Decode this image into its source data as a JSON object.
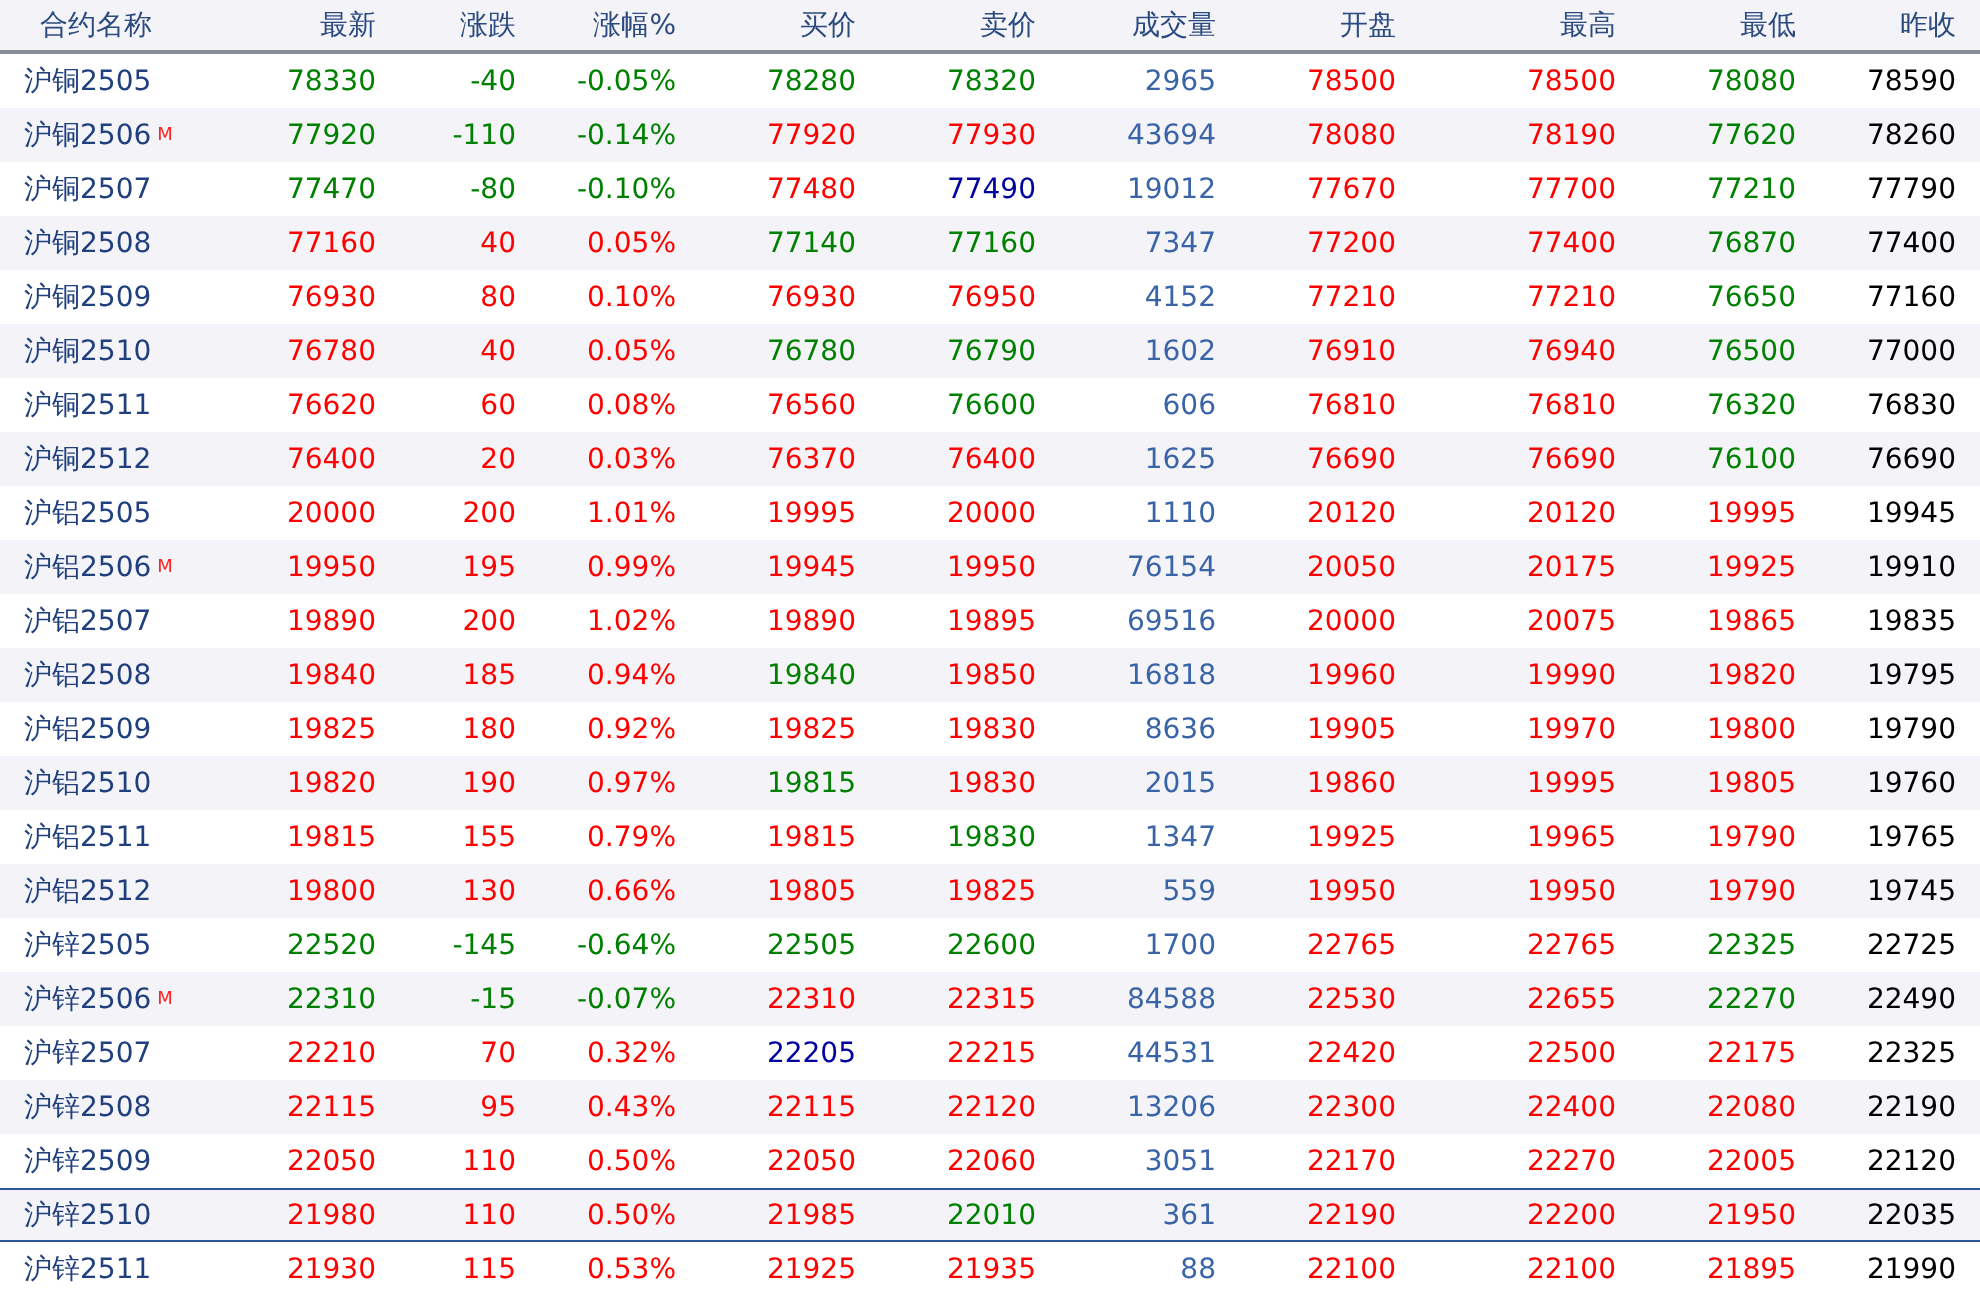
{
  "table": {
    "columns": [
      "合约名称",
      "最新",
      "涨跌",
      "涨幅%",
      "买价",
      "卖价",
      "成交量",
      "开盘",
      "最高",
      "最低",
      "昨收"
    ],
    "rows": [
      {
        "selected": false,
        "cells": [
          {
            "text": "沪铜2505",
            "color": "#1f3f7f"
          },
          {
            "text": "78330",
            "color": "#008000"
          },
          {
            "text": "-40",
            "color": "#008000"
          },
          {
            "text": "-0.05%",
            "color": "#008000"
          },
          {
            "text": "78280",
            "color": "#008000"
          },
          {
            "text": "78320",
            "color": "#008000"
          },
          {
            "text": "2965",
            "color": "#3a64a8"
          },
          {
            "text": "78500",
            "color": "#ff0000"
          },
          {
            "text": "78500",
            "color": "#ff0000"
          },
          {
            "text": "78080",
            "color": "#008000"
          },
          {
            "text": "78590",
            "color": "#000000"
          }
        ]
      },
      {
        "mark": "M",
        "selected": false,
        "cells": [
          {
            "text": "沪铜2506",
            "color": "#1f3f7f"
          },
          {
            "text": "77920",
            "color": "#008000"
          },
          {
            "text": "-110",
            "color": "#008000"
          },
          {
            "text": "-0.14%",
            "color": "#008000"
          },
          {
            "text": "77920",
            "color": "#ff0000"
          },
          {
            "text": "77930",
            "color": "#ff0000"
          },
          {
            "text": "43694",
            "color": "#3a64a8"
          },
          {
            "text": "78080",
            "color": "#ff0000"
          },
          {
            "text": "78190",
            "color": "#ff0000"
          },
          {
            "text": "77620",
            "color": "#008000"
          },
          {
            "text": "78260",
            "color": "#000000"
          }
        ]
      },
      {
        "selected": false,
        "cells": [
          {
            "text": "沪铜2507",
            "color": "#1f3f7f"
          },
          {
            "text": "77470",
            "color": "#008000"
          },
          {
            "text": "-80",
            "color": "#008000"
          },
          {
            "text": "-0.10%",
            "color": "#008000"
          },
          {
            "text": "77480",
            "color": "#ff0000"
          },
          {
            "text": "77490",
            "color": "#0000a0"
          },
          {
            "text": "19012",
            "color": "#3a64a8"
          },
          {
            "text": "77670",
            "color": "#ff0000"
          },
          {
            "text": "77700",
            "color": "#ff0000"
          },
          {
            "text": "77210",
            "color": "#008000"
          },
          {
            "text": "77790",
            "color": "#000000"
          }
        ]
      },
      {
        "selected": false,
        "cells": [
          {
            "text": "沪铜2508",
            "color": "#1f3f7f"
          },
          {
            "text": "77160",
            "color": "#ff0000"
          },
          {
            "text": "40",
            "color": "#ff0000"
          },
          {
            "text": "0.05%",
            "color": "#ff0000"
          },
          {
            "text": "77140",
            "color": "#008000"
          },
          {
            "text": "77160",
            "color": "#008000"
          },
          {
            "text": "7347",
            "color": "#3a64a8"
          },
          {
            "text": "77200",
            "color": "#ff0000"
          },
          {
            "text": "77400",
            "color": "#ff0000"
          },
          {
            "text": "76870",
            "color": "#008000"
          },
          {
            "text": "77400",
            "color": "#000000"
          }
        ]
      },
      {
        "selected": false,
        "cells": [
          {
            "text": "沪铜2509",
            "color": "#1f3f7f"
          },
          {
            "text": "76930",
            "color": "#ff0000"
          },
          {
            "text": "80",
            "color": "#ff0000"
          },
          {
            "text": "0.10%",
            "color": "#ff0000"
          },
          {
            "text": "76930",
            "color": "#ff0000"
          },
          {
            "text": "76950",
            "color": "#ff0000"
          },
          {
            "text": "4152",
            "color": "#3a64a8"
          },
          {
            "text": "77210",
            "color": "#ff0000"
          },
          {
            "text": "77210",
            "color": "#ff0000"
          },
          {
            "text": "76650",
            "color": "#008000"
          },
          {
            "text": "77160",
            "color": "#000000"
          }
        ]
      },
      {
        "selected": false,
        "cells": [
          {
            "text": "沪铜2510",
            "color": "#1f3f7f"
          },
          {
            "text": "76780",
            "color": "#ff0000"
          },
          {
            "text": "40",
            "color": "#ff0000"
          },
          {
            "text": "0.05%",
            "color": "#ff0000"
          },
          {
            "text": "76780",
            "color": "#008000"
          },
          {
            "text": "76790",
            "color": "#008000"
          },
          {
            "text": "1602",
            "color": "#3a64a8"
          },
          {
            "text": "76910",
            "color": "#ff0000"
          },
          {
            "text": "76940",
            "color": "#ff0000"
          },
          {
            "text": "76500",
            "color": "#008000"
          },
          {
            "text": "77000",
            "color": "#000000"
          }
        ]
      },
      {
        "selected": false,
        "cells": [
          {
            "text": "沪铜2511",
            "color": "#1f3f7f"
          },
          {
            "text": "76620",
            "color": "#ff0000"
          },
          {
            "text": "60",
            "color": "#ff0000"
          },
          {
            "text": "0.08%",
            "color": "#ff0000"
          },
          {
            "text": "76560",
            "color": "#ff0000"
          },
          {
            "text": "76600",
            "color": "#008000"
          },
          {
            "text": "606",
            "color": "#3a64a8"
          },
          {
            "text": "76810",
            "color": "#ff0000"
          },
          {
            "text": "76810",
            "color": "#ff0000"
          },
          {
            "text": "76320",
            "color": "#008000"
          },
          {
            "text": "76830",
            "color": "#000000"
          }
        ]
      },
      {
        "selected": false,
        "cells": [
          {
            "text": "沪铜2512",
            "color": "#1f3f7f"
          },
          {
            "text": "76400",
            "color": "#ff0000"
          },
          {
            "text": "20",
            "color": "#ff0000"
          },
          {
            "text": "0.03%",
            "color": "#ff0000"
          },
          {
            "text": "76370",
            "color": "#ff0000"
          },
          {
            "text": "76400",
            "color": "#ff0000"
          },
          {
            "text": "1625",
            "color": "#3a64a8"
          },
          {
            "text": "76690",
            "color": "#ff0000"
          },
          {
            "text": "76690",
            "color": "#ff0000"
          },
          {
            "text": "76100",
            "color": "#008000"
          },
          {
            "text": "76690",
            "color": "#000000"
          }
        ]
      },
      {
        "selected": false,
        "cells": [
          {
            "text": "沪铝2505",
            "color": "#1f3f7f"
          },
          {
            "text": "20000",
            "color": "#ff0000"
          },
          {
            "text": "200",
            "color": "#ff0000"
          },
          {
            "text": "1.01%",
            "color": "#ff0000"
          },
          {
            "text": "19995",
            "color": "#ff0000"
          },
          {
            "text": "20000",
            "color": "#ff0000"
          },
          {
            "text": "1110",
            "color": "#3a64a8"
          },
          {
            "text": "20120",
            "color": "#ff0000"
          },
          {
            "text": "20120",
            "color": "#ff0000"
          },
          {
            "text": "19995",
            "color": "#ff0000"
          },
          {
            "text": "19945",
            "color": "#000000"
          }
        ]
      },
      {
        "mark": "M",
        "selected": false,
        "cells": [
          {
            "text": "沪铝2506",
            "color": "#1f3f7f"
          },
          {
            "text": "19950",
            "color": "#ff0000"
          },
          {
            "text": "195",
            "color": "#ff0000"
          },
          {
            "text": "0.99%",
            "color": "#ff0000"
          },
          {
            "text": "19945",
            "color": "#ff0000"
          },
          {
            "text": "19950",
            "color": "#ff0000"
          },
          {
            "text": "76154",
            "color": "#3a64a8"
          },
          {
            "text": "20050",
            "color": "#ff0000"
          },
          {
            "text": "20175",
            "color": "#ff0000"
          },
          {
            "text": "19925",
            "color": "#ff0000"
          },
          {
            "text": "19910",
            "color": "#000000"
          }
        ]
      },
      {
        "selected": false,
        "cells": [
          {
            "text": "沪铝2507",
            "color": "#1f3f7f"
          },
          {
            "text": "19890",
            "color": "#ff0000"
          },
          {
            "text": "200",
            "color": "#ff0000"
          },
          {
            "text": "1.02%",
            "color": "#ff0000"
          },
          {
            "text": "19890",
            "color": "#ff0000"
          },
          {
            "text": "19895",
            "color": "#ff0000"
          },
          {
            "text": "69516",
            "color": "#3a64a8"
          },
          {
            "text": "20000",
            "color": "#ff0000"
          },
          {
            "text": "20075",
            "color": "#ff0000"
          },
          {
            "text": "19865",
            "color": "#ff0000"
          },
          {
            "text": "19835",
            "color": "#000000"
          }
        ]
      },
      {
        "selected": false,
        "cells": [
          {
            "text": "沪铝2508",
            "color": "#1f3f7f"
          },
          {
            "text": "19840",
            "color": "#ff0000"
          },
          {
            "text": "185",
            "color": "#ff0000"
          },
          {
            "text": "0.94%",
            "color": "#ff0000"
          },
          {
            "text": "19840",
            "color": "#008000"
          },
          {
            "text": "19850",
            "color": "#ff0000"
          },
          {
            "text": "16818",
            "color": "#3a64a8"
          },
          {
            "text": "19960",
            "color": "#ff0000"
          },
          {
            "text": "19990",
            "color": "#ff0000"
          },
          {
            "text": "19820",
            "color": "#ff0000"
          },
          {
            "text": "19795",
            "color": "#000000"
          }
        ]
      },
      {
        "selected": false,
        "cells": [
          {
            "text": "沪铝2509",
            "color": "#1f3f7f"
          },
          {
            "text": "19825",
            "color": "#ff0000"
          },
          {
            "text": "180",
            "color": "#ff0000"
          },
          {
            "text": "0.92%",
            "color": "#ff0000"
          },
          {
            "text": "19825",
            "color": "#ff0000"
          },
          {
            "text": "19830",
            "color": "#ff0000"
          },
          {
            "text": "8636",
            "color": "#3a64a8"
          },
          {
            "text": "19905",
            "color": "#ff0000"
          },
          {
            "text": "19970",
            "color": "#ff0000"
          },
          {
            "text": "19800",
            "color": "#ff0000"
          },
          {
            "text": "19790",
            "color": "#000000"
          }
        ]
      },
      {
        "selected": false,
        "cells": [
          {
            "text": "沪铝2510",
            "color": "#1f3f7f"
          },
          {
            "text": "19820",
            "color": "#ff0000"
          },
          {
            "text": "190",
            "color": "#ff0000"
          },
          {
            "text": "0.97%",
            "color": "#ff0000"
          },
          {
            "text": "19815",
            "color": "#008000"
          },
          {
            "text": "19830",
            "color": "#ff0000"
          },
          {
            "text": "2015",
            "color": "#3a64a8"
          },
          {
            "text": "19860",
            "color": "#ff0000"
          },
          {
            "text": "19995",
            "color": "#ff0000"
          },
          {
            "text": "19805",
            "color": "#ff0000"
          },
          {
            "text": "19760",
            "color": "#000000"
          }
        ]
      },
      {
        "selected": false,
        "cells": [
          {
            "text": "沪铝2511",
            "color": "#1f3f7f"
          },
          {
            "text": "19815",
            "color": "#ff0000"
          },
          {
            "text": "155",
            "color": "#ff0000"
          },
          {
            "text": "0.79%",
            "color": "#ff0000"
          },
          {
            "text": "19815",
            "color": "#ff0000"
          },
          {
            "text": "19830",
            "color": "#008000"
          },
          {
            "text": "1347",
            "color": "#3a64a8"
          },
          {
            "text": "19925",
            "color": "#ff0000"
          },
          {
            "text": "19965",
            "color": "#ff0000"
          },
          {
            "text": "19790",
            "color": "#ff0000"
          },
          {
            "text": "19765",
            "color": "#000000"
          }
        ]
      },
      {
        "selected": false,
        "cells": [
          {
            "text": "沪铝2512",
            "color": "#1f3f7f"
          },
          {
            "text": "19800",
            "color": "#ff0000"
          },
          {
            "text": "130",
            "color": "#ff0000"
          },
          {
            "text": "0.66%",
            "color": "#ff0000"
          },
          {
            "text": "19805",
            "color": "#ff0000"
          },
          {
            "text": "19825",
            "color": "#ff0000"
          },
          {
            "text": "559",
            "color": "#3a64a8"
          },
          {
            "text": "19950",
            "color": "#ff0000"
          },
          {
            "text": "19950",
            "color": "#ff0000"
          },
          {
            "text": "19790",
            "color": "#ff0000"
          },
          {
            "text": "19745",
            "color": "#000000"
          }
        ]
      },
      {
        "selected": false,
        "cells": [
          {
            "text": "沪锌2505",
            "color": "#1f3f7f"
          },
          {
            "text": "22520",
            "color": "#008000"
          },
          {
            "text": "-145",
            "color": "#008000"
          },
          {
            "text": "-0.64%",
            "color": "#008000"
          },
          {
            "text": "22505",
            "color": "#008000"
          },
          {
            "text": "22600",
            "color": "#008000"
          },
          {
            "text": "1700",
            "color": "#3a64a8"
          },
          {
            "text": "22765",
            "color": "#ff0000"
          },
          {
            "text": "22765",
            "color": "#ff0000"
          },
          {
            "text": "22325",
            "color": "#008000"
          },
          {
            "text": "22725",
            "color": "#000000"
          }
        ]
      },
      {
        "mark": "M",
        "selected": false,
        "cells": [
          {
            "text": "沪锌2506",
            "color": "#1f3f7f"
          },
          {
            "text": "22310",
            "color": "#008000"
          },
          {
            "text": "-15",
            "color": "#008000"
          },
          {
            "text": "-0.07%",
            "color": "#008000"
          },
          {
            "text": "22310",
            "color": "#ff0000"
          },
          {
            "text": "22315",
            "color": "#ff0000"
          },
          {
            "text": "84588",
            "color": "#3a64a8"
          },
          {
            "text": "22530",
            "color": "#ff0000"
          },
          {
            "text": "22655",
            "color": "#ff0000"
          },
          {
            "text": "22270",
            "color": "#008000"
          },
          {
            "text": "22490",
            "color": "#000000"
          }
        ]
      },
      {
        "selected": false,
        "cells": [
          {
            "text": "沪锌2507",
            "color": "#1f3f7f"
          },
          {
            "text": "22210",
            "color": "#ff0000"
          },
          {
            "text": "70",
            "color": "#ff0000"
          },
          {
            "text": "0.32%",
            "color": "#ff0000"
          },
          {
            "text": "22205",
            "color": "#0000a0"
          },
          {
            "text": "22215",
            "color": "#ff0000"
          },
          {
            "text": "44531",
            "color": "#3a64a8"
          },
          {
            "text": "22420",
            "color": "#ff0000"
          },
          {
            "text": "22500",
            "color": "#ff0000"
          },
          {
            "text": "22175",
            "color": "#ff0000"
          },
          {
            "text": "22325",
            "color": "#000000"
          }
        ]
      },
      {
        "selected": false,
        "cells": [
          {
            "text": "沪锌2508",
            "color": "#1f3f7f"
          },
          {
            "text": "22115",
            "color": "#ff0000"
          },
          {
            "text": "95",
            "color": "#ff0000"
          },
          {
            "text": "0.43%",
            "color": "#ff0000"
          },
          {
            "text": "22115",
            "color": "#ff0000"
          },
          {
            "text": "22120",
            "color": "#ff0000"
          },
          {
            "text": "13206",
            "color": "#3a64a8"
          },
          {
            "text": "22300",
            "color": "#ff0000"
          },
          {
            "text": "22400",
            "color": "#ff0000"
          },
          {
            "text": "22080",
            "color": "#ff0000"
          },
          {
            "text": "22190",
            "color": "#000000"
          }
        ]
      },
      {
        "selected": false,
        "cells": [
          {
            "text": "沪锌2509",
            "color": "#1f3f7f"
          },
          {
            "text": "22050",
            "color": "#ff0000"
          },
          {
            "text": "110",
            "color": "#ff0000"
          },
          {
            "text": "0.50%",
            "color": "#ff0000"
          },
          {
            "text": "22050",
            "color": "#ff0000"
          },
          {
            "text": "22060",
            "color": "#ff0000"
          },
          {
            "text": "3051",
            "color": "#3a64a8"
          },
          {
            "text": "22170",
            "color": "#ff0000"
          },
          {
            "text": "22270",
            "color": "#ff0000"
          },
          {
            "text": "22005",
            "color": "#ff0000"
          },
          {
            "text": "22120",
            "color": "#000000"
          }
        ]
      },
      {
        "selected": true,
        "cells": [
          {
            "text": "沪锌2510",
            "color": "#1f3f7f"
          },
          {
            "text": "21980",
            "color": "#ff0000"
          },
          {
            "text": "110",
            "color": "#ff0000"
          },
          {
            "text": "0.50%",
            "color": "#ff0000"
          },
          {
            "text": "21985",
            "color": "#ff0000"
          },
          {
            "text": "22010",
            "color": "#008000"
          },
          {
            "text": "361",
            "color": "#3a64a8"
          },
          {
            "text": "22190",
            "color": "#ff0000"
          },
          {
            "text": "22200",
            "color": "#ff0000"
          },
          {
            "text": "21950",
            "color": "#ff0000"
          },
          {
            "text": "22035",
            "color": "#000000"
          }
        ]
      },
      {
        "selected": false,
        "cells": [
          {
            "text": "沪锌2511",
            "color": "#1f3f7f"
          },
          {
            "text": "21930",
            "color": "#ff0000"
          },
          {
            "text": "115",
            "color": "#ff0000"
          },
          {
            "text": "0.53%",
            "color": "#ff0000"
          },
          {
            "text": "21925",
            "color": "#ff0000"
          },
          {
            "text": "21935",
            "color": "#ff0000"
          },
          {
            "text": "88",
            "color": "#3a64a8"
          },
          {
            "text": "22100",
            "color": "#ff0000"
          },
          {
            "text": "22100",
            "color": "#ff0000"
          },
          {
            "text": "21895",
            "color": "#ff0000"
          },
          {
            "text": "21990",
            "color": "#000000"
          }
        ]
      }
    ]
  }
}
